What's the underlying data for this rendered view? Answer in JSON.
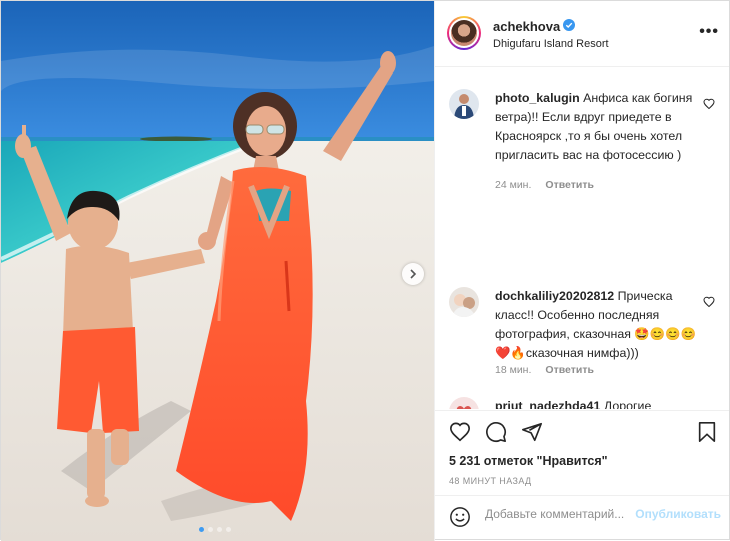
{
  "post": {
    "username": "achekhova",
    "location": "Dhigufaru Island Resort",
    "more_label": "•••"
  },
  "comments": [
    {
      "username": "photo_kalugin",
      "text": "Анфиса как богиня ветра)!! Если вдруг приедете в Красноярск ,то я бы очень хотел пригласить вас на фотосессию )",
      "time": "24 мин.",
      "reply_label": "Ответить"
    },
    {
      "username": "dochkaliliy20202812",
      "text": "Прическа класс!! Особенно последняя фотография, сказочная 🤩😊😊😊❤️🔥сказочная нимфа)))",
      "time": "18 мин.",
      "reply_label": "Ответить"
    },
    {
      "username": "priut_nadezhda41",
      "text": "Дорогие"
    }
  ],
  "likes": {
    "text": "5 231 отметок \"Нравится\""
  },
  "timestamp": "48 МИНУТ НАЗАД",
  "add_comment": {
    "placeholder": "Добавьте комментарий...",
    "publish_label": "Опубликовать"
  },
  "carousel": {
    "count": 4,
    "active_index": 0
  },
  "icons": [
    "verified-badge-icon",
    "heart-icon",
    "comment-icon",
    "share-icon",
    "bookmark-icon",
    "emoji-icon",
    "chevron-right-icon"
  ],
  "colors": {
    "link": "#0095f6",
    "publish_disabled": "#b2dffc",
    "verified": "#3897f0"
  }
}
